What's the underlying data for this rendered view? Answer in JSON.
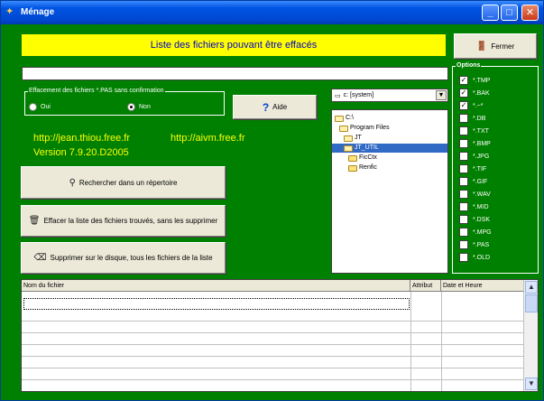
{
  "window": {
    "title": "Ménage",
    "title_icon": "broom-icon",
    "controls": {
      "minimize": "_",
      "maximize": "□",
      "close": "✕"
    }
  },
  "banner": {
    "text": "Liste des fichiers pouvant être effacés"
  },
  "buttons": {
    "fermer": "Fermer",
    "aide": "Aide",
    "rechercher": "Rechercher dans un répertoire",
    "effacer_liste": "Effacer la liste des fichiers trouvés, sans les supprimer",
    "supprimer": "Supprimer sur le disque, tous les fichiers de la liste"
  },
  "path_field": {
    "value": ""
  },
  "effacement": {
    "legend": "Effacement des fichiers *.PAS sans confirmation",
    "oui": "Oui",
    "non": "Non",
    "selected": "non"
  },
  "links": {
    "site1": "http://jean.thiou.free.fr",
    "site2": "http://aivm.free.fr",
    "version": "Version 7.9.20.D2005"
  },
  "drive": {
    "selected": "c: [system]"
  },
  "directories": [
    {
      "label": "C:\\",
      "open": true,
      "selected": false
    },
    {
      "label": "Program Files",
      "open": true,
      "selected": false
    },
    {
      "label": "JT",
      "open": true,
      "selected": false
    },
    {
      "label": "JT_UTIL",
      "open": true,
      "selected": true
    },
    {
      "label": "FicCtx",
      "open": false,
      "selected": false
    },
    {
      "label": "Renfic",
      "open": false,
      "selected": false
    }
  ],
  "options": {
    "legend": "Options",
    "items": [
      {
        "label": "*.TMP",
        "checked": true
      },
      {
        "label": "*.BAK",
        "checked": true
      },
      {
        "label": "*.~*",
        "checked": true
      },
      {
        "label": "*.DB",
        "checked": false
      },
      {
        "label": "*.TXT",
        "checked": false
      },
      {
        "label": "*.BMP",
        "checked": false
      },
      {
        "label": "*.JPG",
        "checked": false
      },
      {
        "label": "*.TIF",
        "checked": false
      },
      {
        "label": "*.GIF",
        "checked": false
      },
      {
        "label": "*.WAV",
        "checked": false
      },
      {
        "label": "*.MID",
        "checked": false
      },
      {
        "label": "*.DSK",
        "checked": false
      },
      {
        "label": "*.MPG",
        "checked": false
      },
      {
        "label": "*.PAS",
        "checked": false
      },
      {
        "label": "*.OLD",
        "checked": false
      }
    ]
  },
  "table": {
    "columns": [
      "Nom du fichier",
      "Attribut",
      "Date et Heure"
    ],
    "rows": []
  }
}
